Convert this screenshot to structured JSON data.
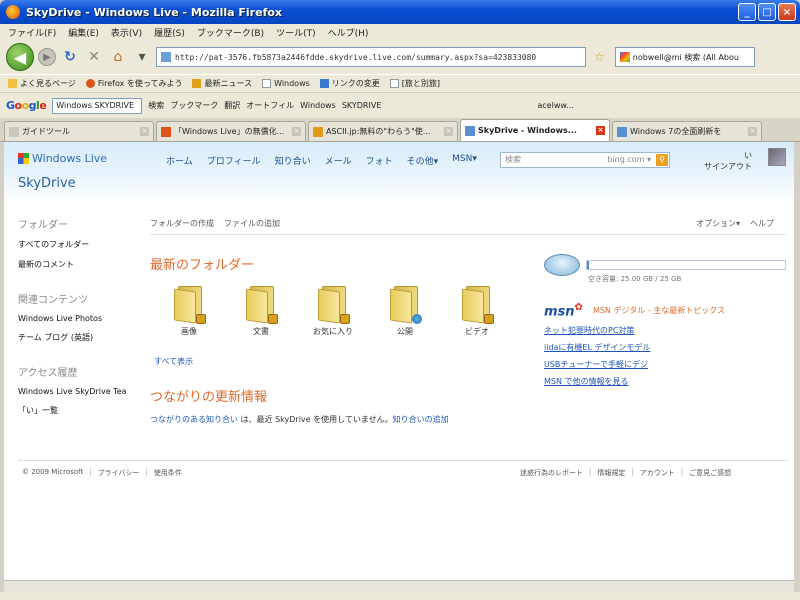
{
  "window": {
    "title": "SkyDrive - Windows Live - Mozilla Firefox",
    "buttons": [
      "_",
      "□",
      "×"
    ]
  },
  "menu": [
    "ファイル(F)",
    "編集(E)",
    "表示(V)",
    "履歴(S)",
    "ブックマーク(B)",
    "ツール(T)",
    "ヘルプ(H)"
  ],
  "nav": {
    "url": "http://pat-3576.fb5873a2446fdde.skydrive.live.com/summary.aspx?sa=423833080",
    "search_value": "nobwell@mi 検索 (All Abou"
  },
  "bookmarks": [
    "よく見るページ",
    "Firefox を使ってみよう",
    "最新ニュース",
    "Windows",
    "リンクの変更",
    "[旅と別旅]"
  ],
  "google_toolbar": {
    "search_value": "Windows SKYDRIVE",
    "items": [
      "検索",
      "ブックマーク",
      "翻訳",
      "オートフィル",
      "Windows",
      "SKYDRIVE",
      "acelww..."
    ]
  },
  "tabs": [
    {
      "label": "ガイドツール",
      "color": "#c9c6ba",
      "active": false
    },
    {
      "label": "「Windows Live」の無償化...",
      "color": "#e0541c",
      "active": false
    },
    {
      "label": "ASCII.jp:無料の\"わらう\"使...",
      "color": "#e39a1a",
      "active": false
    },
    {
      "label": "SkyDrive - Windows...",
      "color": "#5a8fd0",
      "active": true
    },
    {
      "label": "Windows 7の全面刷新を",
      "color": "#5a8fd0",
      "active": false
    }
  ],
  "site": {
    "logo": "Windows Live",
    "product": "SkyDrive",
    "topnav": [
      "ホーム",
      "プロフィール",
      "知り合い",
      "メール",
      "フォト",
      "その他▾",
      "MSN▾"
    ],
    "search_placeholder": "検索",
    "search_hint": "bing.com ▾",
    "user": "い",
    "signout": "サインアウト"
  },
  "sidebar": {
    "folders_head": "フォルダー",
    "folder_items": [
      "すべてのフォルダー",
      "最新のコメント"
    ],
    "related_head": "関連コンテンツ",
    "related_items": [
      "Windows Live Photos",
      "チーム ブログ (英語)"
    ],
    "access_head": "アクセス履歴",
    "access_items": [
      "Windows Live SkyDrive Tea",
      "「い」一覧"
    ]
  },
  "actions": [
    "フォルダーの作成",
    "ファイルの追加"
  ],
  "options": [
    "オプション▾",
    "ヘルプ"
  ],
  "recent": {
    "heading": "最新のフォルダー",
    "folders": [
      {
        "name": "画像",
        "badge": "lock"
      },
      {
        "name": "文書",
        "badge": "lock"
      },
      {
        "name": "お気に入り",
        "badge": "lock"
      },
      {
        "name": "公開",
        "badge": "globe"
      },
      {
        "name": "ビデオ",
        "badge": "lock"
      }
    ],
    "show_all": "すべて表示"
  },
  "updates": {
    "heading": "つながりの更新情報",
    "link1": "つながりのある知り合い",
    "text": " は、最近 SkyDrive を使用していません。",
    "link2": "知り合いの追加"
  },
  "storage": {
    "label": "空き容量: 25.00 GB / 25 GB",
    "used_fraction": 0.01
  },
  "msn": {
    "logo": "msn",
    "title": "MSN デジタル - 主な最新トピックス",
    "links": [
      "ネット犯罪時代のPC対策",
      "iidaに有機EL デザインモデル",
      "USBチューナーで手軽にデジ",
      "MSN で他の情報を見る"
    ]
  },
  "footer": {
    "left": [
      "© 2009 Microsoft",
      "プライバシー",
      "使用条件"
    ],
    "right": [
      "迷惑行為のレポート",
      "情報規定",
      "アカウント",
      "ご意見ご感想"
    ]
  }
}
